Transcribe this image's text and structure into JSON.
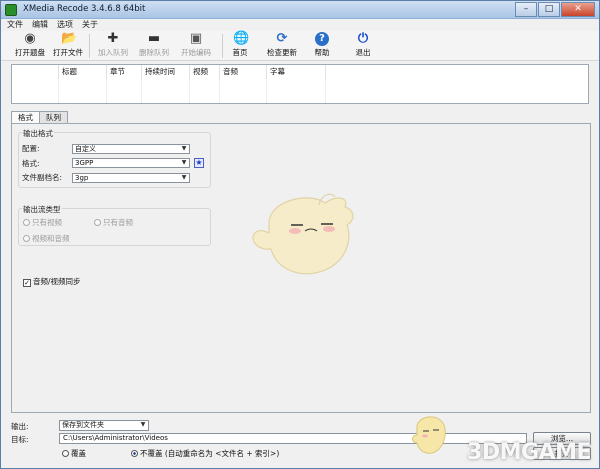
{
  "window": {
    "title": "XMedia Recode 3.4.6.8 64bit",
    "buttons": {
      "minimize": "–",
      "maximize": "□",
      "close": "✕"
    }
  },
  "menu": [
    "文件",
    "编辑",
    "选项",
    "关于"
  ],
  "toolbar": [
    {
      "label": "打开题盘",
      "icon": "disc-icon",
      "glyph": "◉",
      "enabled": true
    },
    {
      "label": "打开文件",
      "icon": "folder-icon",
      "glyph": "📂",
      "enabled": true
    },
    {
      "label": "加入队列",
      "icon": "plus-icon",
      "glyph": "✚",
      "enabled": false
    },
    {
      "label": "删除队列",
      "icon": "minus-icon",
      "glyph": "▬",
      "enabled": false
    },
    {
      "label": "开始编码",
      "icon": "encode-icon",
      "glyph": "▣",
      "enabled": false
    },
    {
      "label": "首页",
      "icon": "globe-icon",
      "glyph": "🌐",
      "enabled": true
    },
    {
      "label": "检查更新",
      "icon": "refresh-icon",
      "glyph": "⟳",
      "enabled": true
    },
    {
      "label": "帮助",
      "icon": "help-icon",
      "glyph": "?",
      "enabled": true
    },
    {
      "label": "退出",
      "icon": "power-icon",
      "glyph": "⏻",
      "enabled": true
    }
  ],
  "file_list": {
    "columns": [
      "",
      "标题",
      "章节",
      "持续时间",
      "视频",
      "音频",
      "字幕",
      ""
    ]
  },
  "tabs": [
    "格式",
    "队列"
  ],
  "output_format": {
    "group_title": "输出格式",
    "profile_label": "配置:",
    "profile_value": "自定义",
    "format_label": "格式:",
    "format_value": "3GPP",
    "extension_label": "文件副档名:",
    "extension_value": "3gp"
  },
  "stream_type": {
    "group_title": "输出流类型",
    "video_only": "只有视频",
    "audio_only": "只有音频",
    "video_audio": "视频和音频"
  },
  "av_sync": {
    "label": "音频/视频同步",
    "checked": true
  },
  "bottom": {
    "output_label": "输出:",
    "output_value": "保存到文件夹",
    "target_label": "目标:",
    "target_path": "C:\\Users\\Administrator\\Videos",
    "browse_button": "浏览...",
    "open_button": "打开",
    "overwrite": "覆盖",
    "no_overwrite": "不覆盖 (自动重命名为 <文件名 + 索引>)"
  },
  "watermark": "3DMGAME",
  "colors": {
    "accent": "#1a3acc",
    "titlebar": "#a9c4e4"
  }
}
